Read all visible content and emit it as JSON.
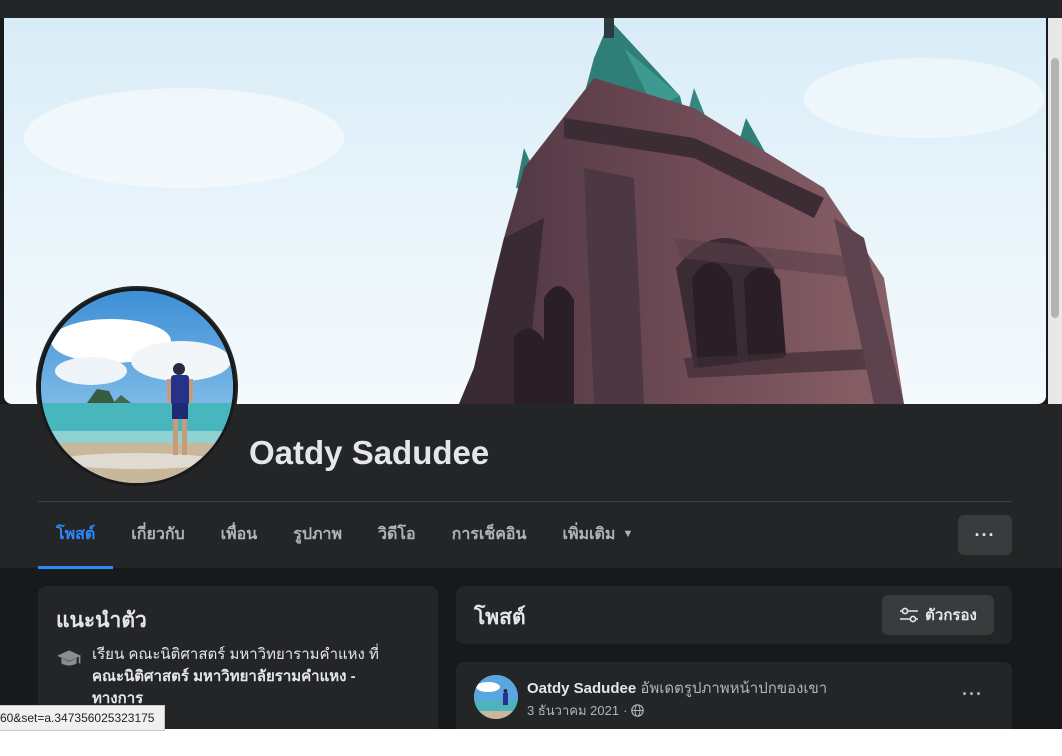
{
  "profile": {
    "name": "Oatdy Sadudee"
  },
  "tabs": [
    {
      "label": "โพสต์",
      "active": true
    },
    {
      "label": "เกี่ยวกับ",
      "active": false
    },
    {
      "label": "เพื่อน",
      "active": false
    },
    {
      "label": "รูปภาพ",
      "active": false
    },
    {
      "label": "วิดีโอ",
      "active": false
    },
    {
      "label": "การเช็คอิน",
      "active": false
    },
    {
      "label": "เพิ่มเติม",
      "active": false
    }
  ],
  "more_button": {
    "icon": "more-horizontal-icon",
    "label": "···"
  },
  "intro": {
    "title": "แนะนำตัว",
    "education_prefix": "เรียน คณะนิติศาสตร์ มหาวิทยารามคำแหง ที่",
    "education_school": "คณะนิติศาสตร์ มหาวิทยาลัยรามคำแหง - ทางการ",
    "icon": "graduation-cap-icon"
  },
  "posts_header": {
    "title": "โพสต์",
    "filter_label": "ตัวกรอง",
    "filter_icon": "sliders-icon"
  },
  "post": {
    "author": "Oatdy Sadudee",
    "action": "อัพเดตรูปภาพหน้าปกของเขา",
    "date": "3 ธันวาคม 2021",
    "separator": "·",
    "privacy_icon": "globe-icon",
    "more_label": "···"
  },
  "status_bar": {
    "url_fragment": "60&set=a.347356025323175"
  },
  "colors": {
    "accent": "#2d88ff",
    "background": "#18191a",
    "card": "#242526",
    "button": "#3a3b3c"
  }
}
